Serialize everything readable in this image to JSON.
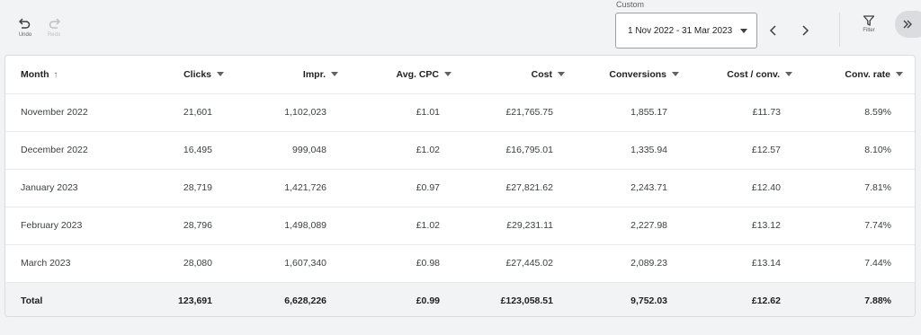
{
  "toolbar": {
    "undo_label": "Undo",
    "redo_label": "Redo",
    "filter_label": "Filter"
  },
  "date_range": {
    "label": "Custom",
    "value": "1 Nov 2022 - 31 Mar 2023"
  },
  "icons": {
    "undo": "undo-icon",
    "redo": "redo-icon",
    "prev": "chevron-left-icon",
    "next": "chevron-right-icon",
    "filter": "filter-icon",
    "expand": "double-chevron-right-icon"
  },
  "table": {
    "columns": [
      "Month",
      "Clicks",
      "Impr.",
      "Avg. CPC",
      "Cost",
      "Conversions",
      "Cost / conv.",
      "Conv. rate"
    ],
    "rows": [
      [
        "November 2022",
        "21,601",
        "1,102,023",
        "£1.01",
        "£21,765.75",
        "1,855.17",
        "£11.73",
        "8.59%"
      ],
      [
        "December 2022",
        "16,495",
        "999,048",
        "£1.02",
        "£16,795.01",
        "1,335.94",
        "£12.57",
        "8.10%"
      ],
      [
        "January 2023",
        "28,719",
        "1,421,726",
        "£0.97",
        "£27,821.62",
        "2,243.71",
        "£12.40",
        "7.81%"
      ],
      [
        "February 2023",
        "28,796",
        "1,498,089",
        "£1.02",
        "£29,231.11",
        "2,227.98",
        "£13.12",
        "7.74%"
      ],
      [
        "March 2023",
        "28,080",
        "1,607,340",
        "£0.98",
        "£27,445.02",
        "2,089.23",
        "£13.14",
        "7.44%"
      ]
    ],
    "total": [
      "Total",
      "123,691",
      "6,628,226",
      "£0.99",
      "£123,058.51",
      "9,752.03",
      "£12.62",
      "7.88%"
    ]
  }
}
